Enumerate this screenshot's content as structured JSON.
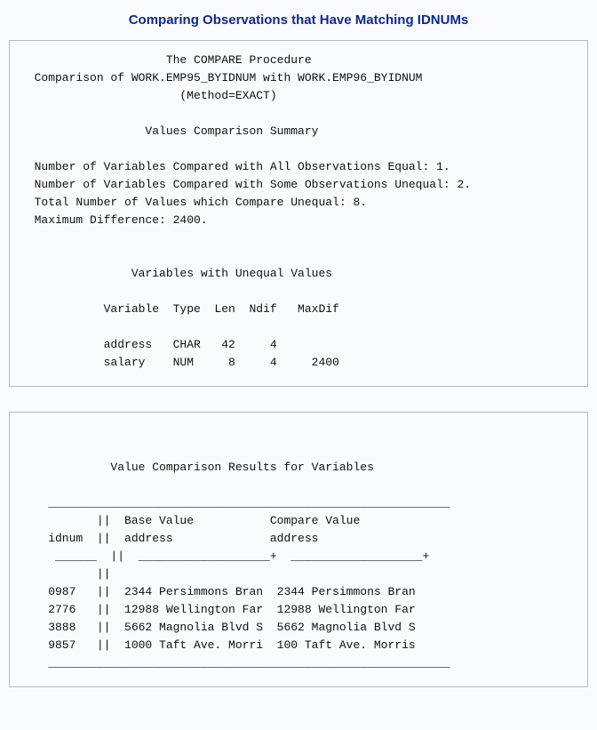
{
  "title": "Comparing Observations that Have Matching IDNUMs",
  "block1": {
    "l1": "                     The COMPARE Procedure",
    "l2": "  Comparison of WORK.EMP95_BYIDNUM with WORK.EMP96_BYIDNUM",
    "l3": "                       (Method=EXACT)",
    "l4": "",
    "l5": "                  Values Comparison Summary",
    "l6": "",
    "l7": "  Number of Variables Compared with All Observations Equal: 1.",
    "l8": "  Number of Variables Compared with Some Observations Unequal: 2.",
    "l9": "  Total Number of Values which Compare Unequal: 8.",
    "l10": "  Maximum Difference: 2400.",
    "l11": "",
    "l12": "",
    "l13": "                Variables with Unequal Values",
    "l14": "",
    "l15": "            Variable  Type  Len  Ndif   MaxDif",
    "l16": "",
    "l17": "            address   CHAR   42     4",
    "l18": "            salary    NUM     8     4     2400",
    "l19": ""
  },
  "block2": {
    "l1": "",
    "l2": "",
    "l3": "             Value Comparison Results for Variables",
    "l4": "",
    "l5": "    __________________________________________________________",
    "l6": "           ||  Base Value           Compare Value",
    "l7": "    idnum  ||  address              address",
    "l8": "     ______  ||  ___________________+  ___________________+",
    "l9": "           ||",
    "l10": "    0987   ||  2344 Persimmons Bran  2344 Persimmons Bran",
    "l11": "    2776   ||  12988 Wellington Far  12988 Wellington Far",
    "l12": "    3888   ||  5662 Magnolia Blvd S  5662 Magnolia Blvd S",
    "l13": "    9857   ||  1000 Taft Ave. Morri  100 Taft Ave. Morris",
    "l14": "    __________________________________________________________"
  }
}
